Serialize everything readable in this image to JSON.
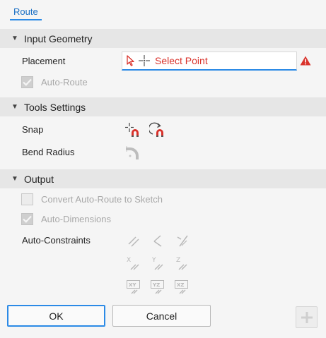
{
  "tabs": [
    {
      "label": "Route",
      "active": true
    }
  ],
  "sections": {
    "input_geometry": {
      "title": "Input Geometry",
      "placement_label": "Placement",
      "select_point_text": "Select Point",
      "auto_route_label": "Auto-Route",
      "auto_route_checked": true,
      "auto_route_enabled": false
    },
    "tools_settings": {
      "title": "Tools Settings",
      "snap_label": "Snap",
      "bend_radius_label": "Bend Radius"
    },
    "output": {
      "title": "Output",
      "convert_label": "Convert Auto-Route to Sketch",
      "convert_checked": false,
      "auto_dimensions_label": "Auto-Dimensions",
      "auto_dimensions_checked": true,
      "auto_constraints_label": "Auto-Constraints",
      "constraint_icon_labels": {
        "x": "X",
        "y": "Y",
        "z": "Z",
        "xy": "XY",
        "yz": "YZ",
        "xz": "XZ"
      }
    }
  },
  "buttons": {
    "ok": "OK",
    "cancel": "Cancel"
  },
  "icons": {
    "collapse": "triangle-down-icon",
    "select_point": "arrow-cursor-icon",
    "warning": "warning-triangle-icon",
    "snap_point": "snap-point-magnet-icon",
    "snap_rotate": "snap-rotate-magnet-icon",
    "bend_radius": "bend-radius-icon",
    "add": "plus-icon"
  },
  "colors": {
    "accent": "#2b8ae6",
    "error": "#d9322b",
    "disabled_text": "#a8a8a8",
    "section_bg": "#e6e6e6",
    "panel_bg": "#f5f5f5"
  }
}
